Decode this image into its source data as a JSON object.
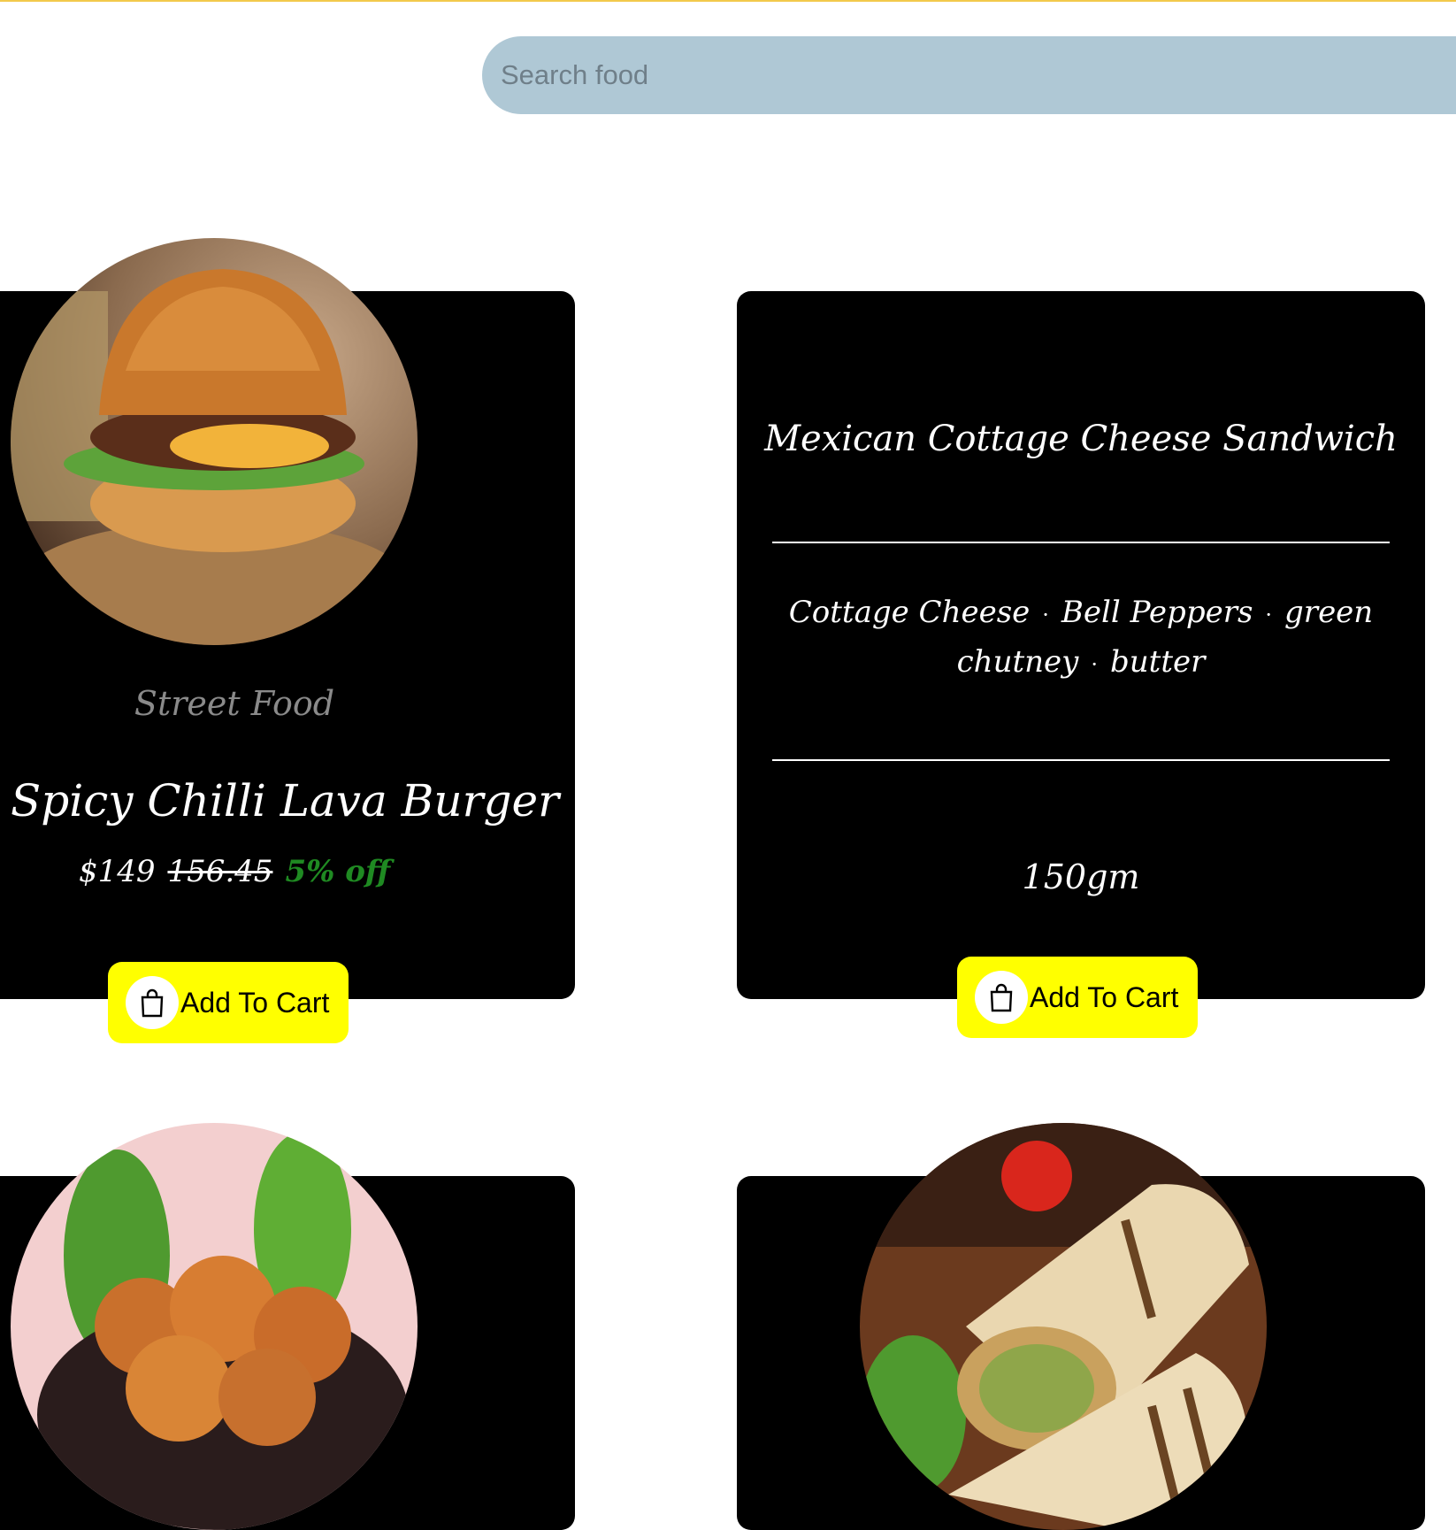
{
  "search": {
    "placeholder": "Search food"
  },
  "products": [
    {
      "category": "Street Food",
      "title": "Spicy Chilli Lava Burger",
      "price": "$149",
      "old_price": "156.45",
      "discount": "5% off",
      "cart_label": "Add To Cart",
      "image_icon": "burger-image"
    },
    {
      "title": "Mexican Cottage Cheese Sandwich",
      "ingredients": [
        "Cottage Cheese",
        "Bell Peppers",
        "green chutney",
        "butter"
      ],
      "weight": "150gm",
      "cart_label": "Add To Cart"
    },
    {
      "image_icon": "fried-chicken-image"
    },
    {
      "image_icon": "wrap-roll-image"
    }
  ],
  "colors": {
    "accent": "#ffff00",
    "card": "#000000",
    "search_bg": "#afc8d5",
    "discount": "#1f8a22",
    "top_border": "#f2c94c"
  }
}
